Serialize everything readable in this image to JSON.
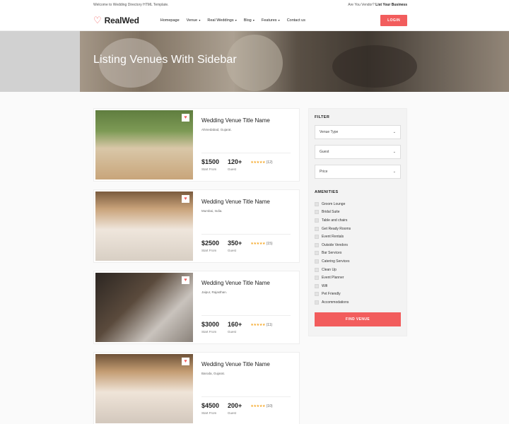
{
  "topbar": {
    "welcome": "Welcome to Wedding Directory HTML Template.",
    "vendor_q": "Are You Vendor?",
    "vendor_link": "List Your Business"
  },
  "nav": {
    "logo": "RealWed",
    "items": [
      {
        "label": "Homepage",
        "dropdown": false
      },
      {
        "label": "Venue",
        "dropdown": true
      },
      {
        "label": "Real Weddings",
        "dropdown": true
      },
      {
        "label": "Blog",
        "dropdown": true
      },
      {
        "label": "Features",
        "dropdown": true
      },
      {
        "label": "Contact us",
        "dropdown": false
      }
    ],
    "login": "LOGIN"
  },
  "hero": {
    "title": "Listing Venues With Sidebar"
  },
  "listings": [
    {
      "title": "Wedding Venue Title Name",
      "location": "Ahmedabad, Gujarat.",
      "price": "$1500",
      "price_label": "Start From",
      "guests": "120+",
      "guests_label": "Guest",
      "rating": 5,
      "reviews": "(12)"
    },
    {
      "title": "Wedding Venue Title Name",
      "location": "Mumbai, India.",
      "price": "$2500",
      "price_label": "Start From",
      "guests": "350+",
      "guests_label": "Guest",
      "rating": 5,
      "reviews": "(15)"
    },
    {
      "title": "Wedding Venue Title Name",
      "location": "Jaipur, Rajasthan.",
      "price": "$3000",
      "price_label": "Start From",
      "guests": "160+",
      "guests_label": "Guest",
      "rating": 5,
      "reviews": "(11)"
    },
    {
      "title": "Wedding Venue Title Name",
      "location": "Baroda, Gujarat.",
      "price": "$4500",
      "price_label": "Start From",
      "guests": "200+",
      "guests_label": "Guest",
      "rating": 5,
      "reviews": "(10)"
    }
  ],
  "filter": {
    "heading": "FILTER",
    "selects": [
      "Venue Type",
      "Guest",
      "Price"
    ],
    "amenities_heading": "AMENITIES",
    "amenities": [
      "Groom Lounge",
      "Bridal Suite",
      "Table and chairs",
      "Get Ready Rooms",
      "Event Rentals",
      "Outside Vendors",
      "Bar Services",
      "Catering Services",
      "Clean Up",
      "Event Planner",
      "Wifi",
      "Pet Friendly",
      "Accommodations"
    ],
    "button": "FIND VENUE"
  },
  "colors": {
    "accent": "#f25d5d",
    "star": "#f5a623"
  }
}
